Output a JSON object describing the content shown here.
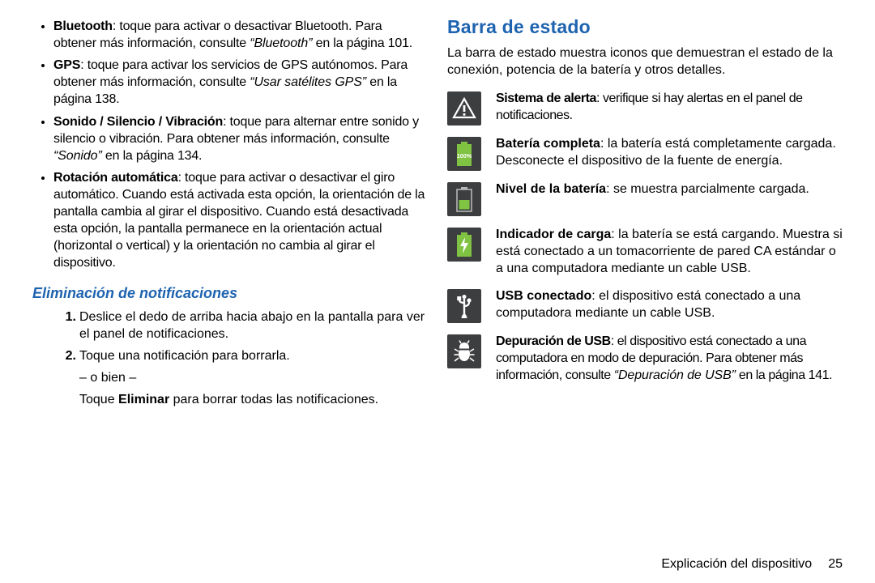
{
  "left": {
    "bullets": [
      {
        "lead": "Bluetooth",
        "text": ": toque para activar o desactivar Bluetooth. Para obtener más información, consulte ",
        "link": "“Bluetooth”",
        "tail": " en la página 101."
      },
      {
        "lead": "GPS",
        "text": ": toque para activar los servicios de GPS autónomos. Para obtener más información, consulte ",
        "link": "“Usar satélites GPS”",
        "tail": " en la página 138."
      },
      {
        "lead": "Sonido / Silencio / Vibración",
        "text": ": toque para alternar entre sonido y silencio o vibración. Para obtener más información, consulte ",
        "link": "“Sonido”",
        "tail": " en la página 134."
      },
      {
        "lead": "Rotación automática",
        "text": ": toque para activar o desactivar el giro automático. Cuando está activada esta opción, la orientación de la pantalla cambia al girar el dispositivo. Cuando está desactivada esta opción, la pantalla permanece en la orientación actual (horizontal o vertical) y la orientación no cambia al girar el dispositivo.",
        "link": "",
        "tail": ""
      }
    ],
    "subhead": "Eliminación de notificaciones",
    "steps": [
      {
        "num": "1.",
        "text": "Deslice el dedo de arriba hacia abajo en la pantalla para ver el panel de notificaciones."
      },
      {
        "num": "2.",
        "text": "Toque una notificación para borrarla.",
        "or": "– o bien –",
        "or_follow_pre": "Toque ",
        "or_follow_bold": "Eliminar",
        "or_follow_post": " para borrar todas las notificaciones."
      }
    ]
  },
  "right": {
    "title": "Barra de estado",
    "intro": "La barra de estado muestra iconos que demuestran el estado de la conexión, potencia de la batería y otros detalles.",
    "rows": [
      {
        "icon": "alert-icon",
        "lead": "Sistema de alerta",
        "text": ": verifique si hay alertas en el panel de notificaciones.",
        "condensed": true
      },
      {
        "icon": "battery-full-icon",
        "lead": "Batería completa",
        "text": ": la batería está completamente cargada. Desconecte el dispositivo de la fuente de energía."
      },
      {
        "icon": "battery-level-icon",
        "lead": "Nivel de la batería",
        "text": ": se muestra parcialmente cargada."
      },
      {
        "icon": "battery-charging-icon",
        "lead": "Indicador de carga",
        "text": ": la batería se está cargando. Muestra si está conectado a un tomacorriente de pared CA estándar o a una computadora mediante un cable USB."
      },
      {
        "icon": "usb-icon",
        "lead": "USB conectado",
        "text": ": el dispositivo está conectado a una computadora mediante un cable USB."
      },
      {
        "icon": "usb-debug-icon",
        "lead": "Depuración de USB",
        "text_pre": ": el dispositivo está conectado a una computadora en modo de depuración. Para obtener más información, consulte ",
        "link": "“Depuración de USB”",
        "text_post": " en la página 141.",
        "condensed": true
      }
    ],
    "battery_full_label": "100%"
  },
  "footer": {
    "label": "Explicación del dispositivo",
    "page": "25"
  }
}
